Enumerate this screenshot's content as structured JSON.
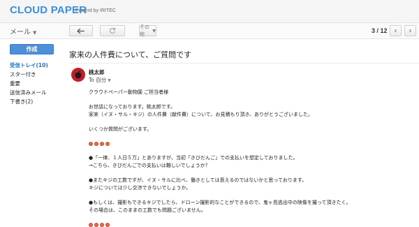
{
  "header": {
    "brand": "CLOUD PAPER",
    "powered_by": "Powerd by IRITEC"
  },
  "toolbar": {
    "mail_menu": "メール",
    "reply_icon": "reply-arrow-icon",
    "refresh_icon": "refresh-icon",
    "more_label": "その他",
    "pager": "3 / 12",
    "prev_icon": "chevron-left-icon",
    "next_icon": "chevron-right-icon"
  },
  "sidebar": {
    "compose_label": "作成",
    "items": [
      {
        "label": "受信トレイ(10)",
        "active": true
      },
      {
        "label": "スター付き",
        "active": false
      },
      {
        "label": "重要",
        "active": false
      },
      {
        "label": "送信済みメール",
        "active": false
      },
      {
        "label": "下書き(2)",
        "active": false
      }
    ]
  },
  "message": {
    "subject": "家来の人件費について、ご質問です",
    "sender": "桃太郎",
    "recipient": "To 自分",
    "lines": [
      "クラウドペーパー動物園 ご担当者様",
      "",
      "お世話になっております。桃太郎です。",
      "家来（イヌ・サル・キジ）の人件費（献件費）について、お見積もり頂き、ありがとうございました。",
      "",
      "いくつか質問がございます。",
      "",
      "●「一律、１人日５万」とありますが、当初「きびだんご」での支払いを想定しておりました。",
      "→こちら、きびだんごでの支払いは難しいでしょうか？",
      "",
      "●またキジの工数ですが、イヌ・サルに比べ、働きとしては衰えるのではないかと思っております。",
      "キジについては少し交渉できないでしょうか。",
      "",
      "●もしくは、撮影もできるキジでしたら、ドローン撮影的なことができるので、鬼ヶ島逃出中の映像を撮って頂きたく。",
      "その場合は、このままの工数でも問題ございません。"
    ]
  },
  "colors": {
    "brand": "#3c8fd8",
    "compose": "#4f8fd9",
    "active_nav": "#1a73c8",
    "avatar": "#c01d28"
  }
}
